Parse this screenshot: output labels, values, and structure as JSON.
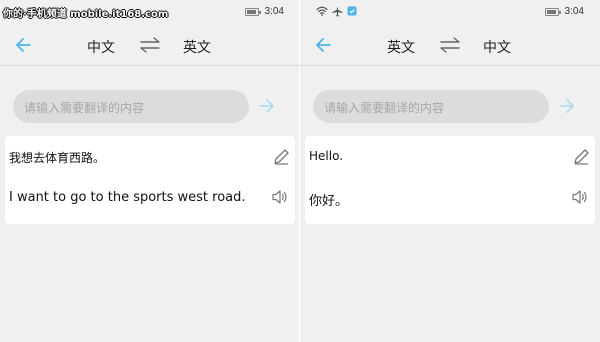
{
  "watermark": "你的·手机频道 mobile.it168.com",
  "colors": {
    "accent": "#4db5e8",
    "background": "#f0f0f1",
    "card": "#ffffff",
    "search_bg": "#dcdcdd"
  },
  "left": {
    "status": {
      "time": "3:04"
    },
    "nav": {
      "source_lang": "中文",
      "target_lang": "英文"
    },
    "search": {
      "placeholder": "请输入需要翻译的内容"
    },
    "card": {
      "source_text": "我想去体育西路。",
      "translated_text": "I want to go to the sports west road."
    }
  },
  "right": {
    "status": {
      "time": "3:04",
      "icons": [
        "wifi-icon",
        "airplane-icon",
        "notification-icon"
      ]
    },
    "nav": {
      "source_lang": "英文",
      "target_lang": "中文"
    },
    "search": {
      "placeholder": "请输入需要翻译的内容"
    },
    "card": {
      "source_text": "Hello.",
      "translated_text": "你好。"
    }
  }
}
